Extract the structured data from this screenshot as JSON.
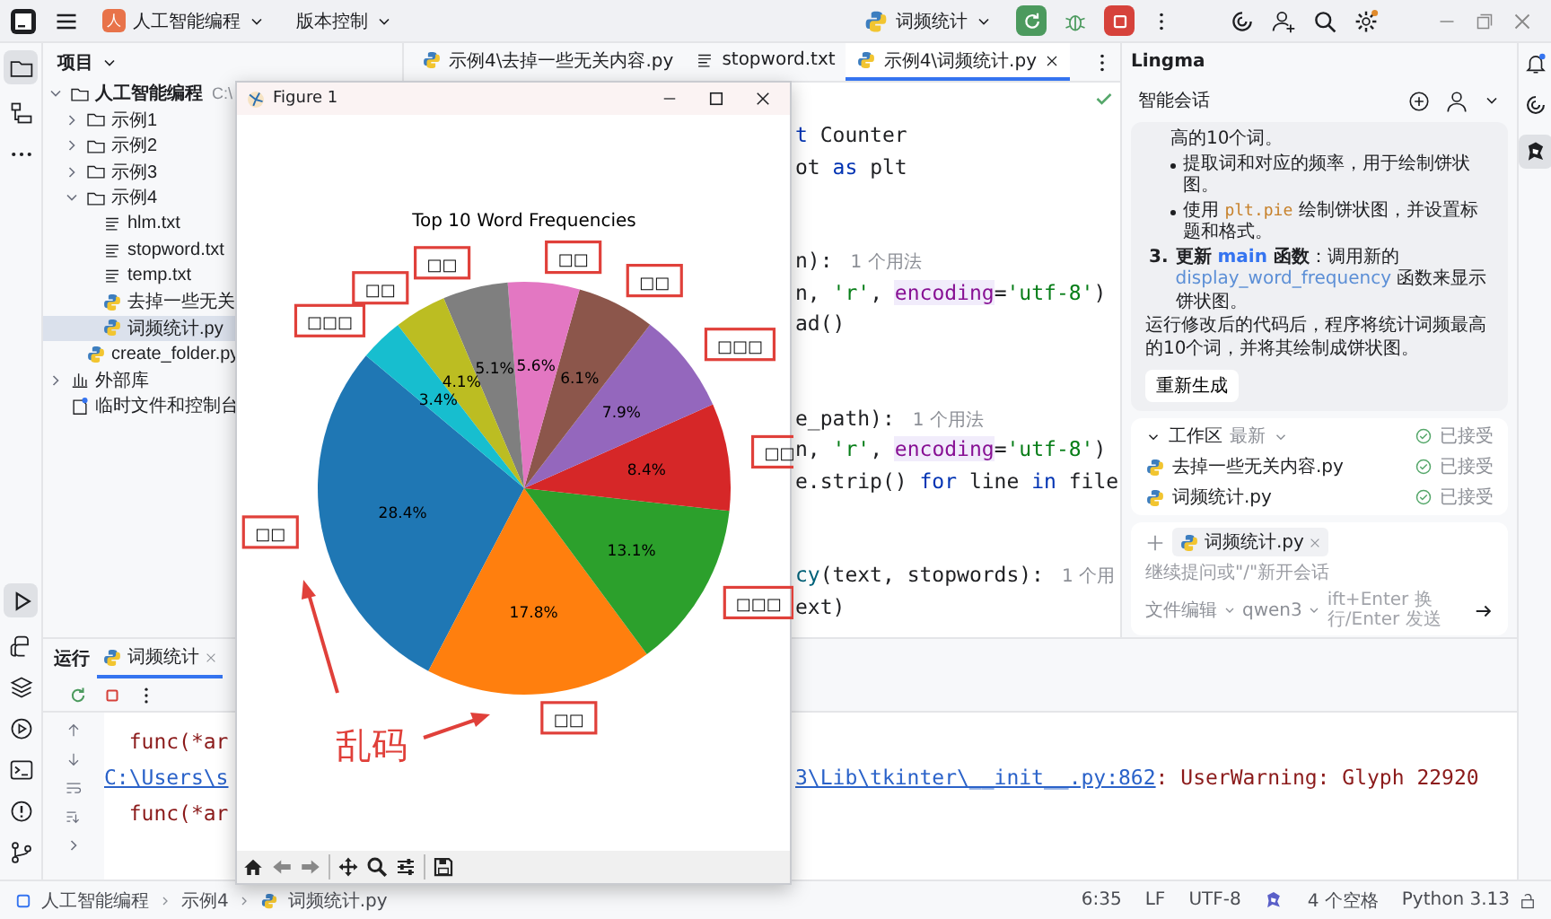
{
  "title_bar": {
    "project_badge": "人",
    "project": "人工智能编程",
    "vcs": "版本控制",
    "run_config": "词频统计"
  },
  "project_panel": {
    "title": "项目",
    "tree": [
      {
        "label": "人工智能编程",
        "path": "C:\\",
        "kind": "folder",
        "expanded": true,
        "selected": false,
        "children": [
          {
            "label": "示例1",
            "kind": "folder",
            "expanded": false,
            "selected": false
          },
          {
            "label": "示例2",
            "kind": "folder",
            "expanded": false,
            "selected": false
          },
          {
            "label": "示例3",
            "kind": "folder",
            "expanded": false,
            "selected": false
          },
          {
            "label": "示例4",
            "kind": "folder",
            "expanded": true,
            "selected": false,
            "children": [
              {
                "label": "hlm.txt",
                "kind": "txt",
                "selected": false
              },
              {
                "label": "stopword.txt",
                "kind": "txt",
                "selected": false
              },
              {
                "label": "temp.txt",
                "kind": "txt",
                "selected": false
              },
              {
                "label": "去掉一些无关",
                "kind": "py",
                "selected": false
              },
              {
                "label": "词频统计.py",
                "kind": "py",
                "selected": true
              }
            ]
          },
          {
            "label": "create_folder.py",
            "kind": "py",
            "selected": false
          }
        ]
      },
      {
        "label": "外部库",
        "kind": "lib",
        "expanded": false,
        "selected": false
      },
      {
        "label": "临时文件和控制台",
        "kind": "scratch",
        "selected": false
      }
    ]
  },
  "editor": {
    "tabs": [
      {
        "label": "示例4\\去掉一些无关内容.py",
        "kind": "py",
        "selected": false
      },
      {
        "label": "stopword.txt",
        "kind": "txt",
        "selected": false
      },
      {
        "label": "示例4\\词频统计.py",
        "kind": "py",
        "selected": true
      }
    ],
    "code_blocks": [
      {
        "lines": [
          [
            {
              "text": "t",
              "kind": "kw"
            },
            {
              "text": " Counter",
              "kind": "plain"
            }
          ],
          [
            {
              "text": "ot ",
              "kind": "plain"
            },
            {
              "text": "as",
              "kind": "kw"
            },
            {
              "text": " plt",
              "kind": "plain"
            }
          ]
        ]
      },
      {
        "lines": [
          [
            {
              "text": "n):",
              "kind": "plain"
            },
            {
              "text": "1 个用法",
              "kind": "hint"
            }
          ],
          [
            {
              "text": "n, ",
              "kind": "plain"
            },
            {
              "text": "'r'",
              "kind": "str"
            },
            {
              "text": ", ",
              "kind": "plain"
            },
            {
              "text": "encoding",
              "kind": "param"
            },
            {
              "text": "=",
              "kind": "plain"
            },
            {
              "text": "'utf-8'",
              "kind": "str"
            },
            {
              "text": ")",
              "kind": "plain"
            }
          ],
          [
            {
              "text": "ad()",
              "kind": "plain"
            }
          ]
        ]
      },
      {
        "lines": [
          [
            {
              "text": "e_path):",
              "kind": "plain"
            },
            {
              "text": "1 个用法",
              "kind": "hint"
            }
          ],
          [
            {
              "text": "n, ",
              "kind": "plain"
            },
            {
              "text": "'r'",
              "kind": "str"
            },
            {
              "text": ", ",
              "kind": "plain"
            },
            {
              "text": "encoding",
              "kind": "param"
            },
            {
              "text": "=",
              "kind": "plain"
            },
            {
              "text": "'utf-8'",
              "kind": "str"
            },
            {
              "text": ")",
              "kind": "plain"
            }
          ],
          [
            {
              "text": "e.strip() ",
              "kind": "plain"
            },
            {
              "text": "for",
              "kind": "kw"
            },
            {
              "text": " line ",
              "kind": "plain"
            },
            {
              "text": "in",
              "kind": "kw"
            },
            {
              "text": " file",
              "kind": "plain"
            }
          ]
        ]
      },
      {
        "lines": [
          [
            {
              "text": "cy",
              "kind": "fn"
            },
            {
              "text": "(text, stopwords):",
              "kind": "plain"
            },
            {
              "text": "1 个用",
              "kind": "hint"
            }
          ],
          [
            {
              "text": "ext)",
              "kind": "plain"
            }
          ]
        ]
      }
    ]
  },
  "figure": {
    "title": "Figure 1",
    "chart_data": {
      "type": "pie",
      "title": "Top 10 Word Frequencies",
      "categories": [
        "□□",
        "□□",
        "□□□",
        "□□",
        "□□□",
        "□□",
        "□□",
        "□□",
        "□□",
        "□□□"
      ],
      "values": [
        28.4,
        17.8,
        13.1,
        8.4,
        7.9,
        6.1,
        5.6,
        5.1,
        4.1,
        3.4
      ],
      "value_labels": [
        "28.4%",
        "17.8%",
        "13.1%",
        "8.4%",
        "7.9%",
        "6.1%",
        "5.6%",
        "5.1%",
        "4.1%",
        "3.4%"
      ]
    },
    "annotation": {
      "text": "乱码"
    }
  },
  "lingma": {
    "title": "Lingma",
    "section": "智能会话",
    "message": [
      {
        "kind": "cont",
        "parts": [
          {
            "text": "高的10个词。",
            "kind": "plain"
          }
        ]
      },
      {
        "kind": "bullet",
        "parts": [
          {
            "text": "提取词和对应的频率，用于绘制饼状图。",
            "kind": "plain"
          }
        ]
      },
      {
        "kind": "bullet",
        "parts": [
          {
            "text": "使用 ",
            "kind": "plain"
          },
          {
            "text": "plt.pie",
            "kind": "code"
          },
          {
            "text": " 绘制饼状图，并设置标题和格式。",
            "kind": "plain"
          }
        ]
      },
      {
        "kind": "numbered",
        "number": "3.",
        "parts": [
          {
            "text": "更新 ",
            "kind": "bold"
          },
          {
            "text": "main",
            "kind": "keyword"
          },
          {
            "text": " 函数",
            "kind": "bold"
          },
          {
            "text": "：调用新的 ",
            "kind": "plain"
          },
          {
            "text": "display_word_frequency",
            "kind": "link"
          },
          {
            "text": " 函数来显示饼状图。",
            "kind": "plain"
          }
        ]
      },
      {
        "kind": "para",
        "parts": [
          {
            "text": "运行修改后的代码后，程序将统计词频最高的10个词，并将其绘制成饼状图。",
            "kind": "plain"
          }
        ]
      }
    ],
    "regenerate": "重新生成",
    "workspace": {
      "title": "工作区",
      "filter": "最新",
      "status": "已接受",
      "files": [
        {
          "name": "去掉一些无关内容.py",
          "status": "已接受"
        },
        {
          "name": "词频统计.py",
          "status": "已接受"
        }
      ]
    },
    "input": {
      "attachment": "词频统计.py",
      "placeholder": "继续提问或\"/\"新开会话",
      "mode": "文件编辑",
      "model": "qwen3",
      "hint": "ift+Enter 换行/Enter 发送"
    }
  },
  "run_panel": {
    "title": "运行",
    "tabs": [
      {
        "label": "词频统计",
        "selected": true
      }
    ],
    "output": [
      {
        "left": [
          {
            "text": "  func(*ar",
            "kind": "err"
          }
        ]
      },
      {
        "left": [
          {
            "text": "C:\\Users\\s",
            "kind": "link"
          }
        ],
        "right": [
          {
            "text": "3\\Lib\\tkinter\\__init__.py:862",
            "kind": "link"
          },
          {
            "text": ": UserWarning: Glyph 22920",
            "kind": "err"
          }
        ]
      },
      {
        "left": [
          {
            "text": "  func(*ar",
            "kind": "err"
          }
        ]
      }
    ]
  },
  "status_bar": {
    "breadcrumb": [
      "人工智能编程",
      "示例4",
      "词频统计.py"
    ],
    "items": [
      "6:35",
      "LF",
      "UTF-8",
      "4 个空格",
      "Python 3.13"
    ]
  }
}
